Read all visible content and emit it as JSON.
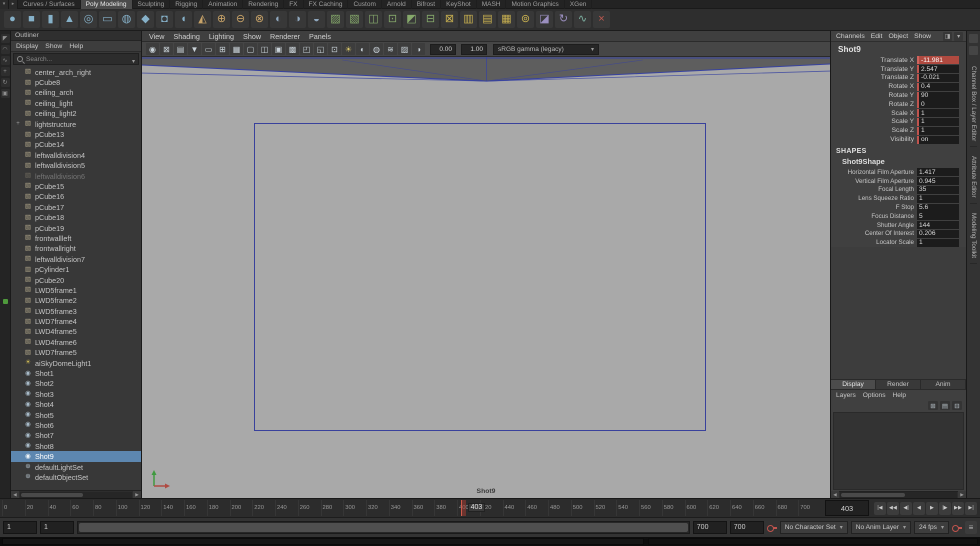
{
  "shelf": {
    "tabs": [
      {
        "label": "Curves / Surfaces"
      },
      {
        "label": "Poly Modeling",
        "cls": "active"
      },
      {
        "label": "Sculpting"
      },
      {
        "label": "Rigging"
      },
      {
        "label": "Animation"
      },
      {
        "label": "Rendering"
      },
      {
        "label": "FX"
      },
      {
        "label": "FX Caching"
      },
      {
        "label": "Custom"
      },
      {
        "label": "Arnold"
      },
      {
        "label": "Bifrost"
      },
      {
        "label": "KeyShot"
      },
      {
        "label": "MASH"
      },
      {
        "label": "Motion Graphics"
      },
      {
        "label": "XGen"
      }
    ],
    "icons": [
      {
        "name": "poly-sphere-icon",
        "glyph": "●",
        "color": "#86b1c9"
      },
      {
        "name": "poly-cube-icon",
        "glyph": "■",
        "color": "#86b1c9"
      },
      {
        "name": "poly-cylinder-icon",
        "glyph": "▮",
        "color": "#86b1c9"
      },
      {
        "name": "poly-cone-icon",
        "glyph": "▲",
        "color": "#86b1c9"
      },
      {
        "name": "poly-torus-icon",
        "glyph": "◎",
        "color": "#86b1c9"
      },
      {
        "name": "poly-plane-icon",
        "glyph": "▭",
        "color": "#86b1c9"
      },
      {
        "name": "poly-disc-icon",
        "glyph": "◍",
        "color": "#86b1c9"
      },
      {
        "name": "platonic-solid-icon",
        "glyph": "◆",
        "color": "#86b1c9"
      },
      {
        "name": "poly-pipe-icon",
        "glyph": "◘",
        "color": "#86b1c9"
      },
      {
        "name": "poly-helix-icon",
        "glyph": "◖",
        "color": "#86b1c9"
      },
      {
        "name": "sculpt-tool-icon",
        "glyph": "◭",
        "color": "#c9a469"
      },
      {
        "name": "combine-icon",
        "glyph": "⊕",
        "color": "#c9a469"
      },
      {
        "name": "separate-icon",
        "glyph": "⊖",
        "color": "#c9a469"
      },
      {
        "name": "extract-icon",
        "glyph": "⊗",
        "color": "#c9a469"
      },
      {
        "name": "boolean-union-icon",
        "glyph": "◐",
        "color": "#8fa7bd"
      },
      {
        "name": "boolean-difference-icon",
        "glyph": "◑",
        "color": "#8fa7bd"
      },
      {
        "name": "boolean-intersection-icon",
        "glyph": "◒",
        "color": "#8fa7bd"
      },
      {
        "name": "smooth-icon",
        "glyph": "▨",
        "color": "#86a96b"
      },
      {
        "name": "reduce-icon",
        "glyph": "▧",
        "color": "#86a96b"
      },
      {
        "name": "mirror-icon",
        "glyph": "◫",
        "color": "#86a96b"
      },
      {
        "name": "extrude-icon",
        "glyph": "⊡",
        "color": "#86a96b"
      },
      {
        "name": "bevel-icon",
        "glyph": "◩",
        "color": "#86a96b"
      },
      {
        "name": "bridge-icon",
        "glyph": "⊟",
        "color": "#86a96b"
      },
      {
        "name": "multi-cut-icon",
        "glyph": "⊠",
        "color": "#c8b050"
      },
      {
        "name": "insert-edge-loop-icon",
        "glyph": "▥",
        "color": "#c8b050"
      },
      {
        "name": "offset-edge-loop-icon",
        "glyph": "▤",
        "color": "#c8b050"
      },
      {
        "name": "quad-draw-icon",
        "glyph": "▦",
        "color": "#c8b050"
      },
      {
        "name": "target-weld-icon",
        "glyph": "⊚",
        "color": "#c8b050"
      },
      {
        "name": "crease-tool-icon",
        "glyph": "◪",
        "color": "#9b8fc0"
      },
      {
        "name": "spin-edge-icon",
        "glyph": "↻",
        "color": "#9b8fc0"
      },
      {
        "name": "project-curve-icon",
        "glyph": "∿",
        "color": "#7fb3a3"
      },
      {
        "name": "cut-tool-icon",
        "glyph": "×",
        "color": "#c05a50"
      }
    ]
  },
  "toolbox": {
    "tools": [
      {
        "name": "select-tool-icon",
        "glyph": "◤"
      },
      {
        "name": "lasso-tool-icon",
        "glyph": "◠"
      },
      {
        "name": "paint-select-tool-icon",
        "glyph": "∿"
      },
      {
        "name": "move-tool-icon",
        "glyph": "+"
      },
      {
        "name": "rotate-tool-icon",
        "glyph": "↻"
      },
      {
        "name": "scale-tool-icon",
        "glyph": "▣"
      }
    ]
  },
  "outliner": {
    "title": "Outliner",
    "menus": [
      "Display",
      "Show",
      "Help"
    ],
    "search_placeholder": "Search...",
    "items": [
      {
        "label": "center_arch_right",
        "glyph": "▧",
        "color": "#b3a98c",
        "exp": ""
      },
      {
        "label": "pCube8",
        "glyph": "▧",
        "color": "#b3a98c",
        "exp": ""
      },
      {
        "label": "ceiling_arch",
        "glyph": "▧",
        "color": "#b3a98c",
        "exp": ""
      },
      {
        "label": "ceiling_light",
        "glyph": "▧",
        "color": "#b3a98c",
        "exp": ""
      },
      {
        "label": "ceiling_light2",
        "glyph": "▧",
        "color": "#b3a98c",
        "exp": ""
      },
      {
        "label": "lightstructure",
        "glyph": "▧",
        "color": "#b3a98c",
        "exp": "+"
      },
      {
        "label": "pCube13",
        "glyph": "▧",
        "color": "#b3a98c",
        "exp": ""
      },
      {
        "label": "pCube14",
        "glyph": "▧",
        "color": "#b3a98c",
        "exp": ""
      },
      {
        "label": "leftwalldivision4",
        "glyph": "▧",
        "color": "#b3a98c",
        "exp": ""
      },
      {
        "label": "leftwalldivision5",
        "glyph": "▧",
        "color": "#b3a98c",
        "exp": ""
      },
      {
        "label": "leftwalldivision6",
        "glyph": "▧",
        "color": "#b3a98c",
        "exp": "",
        "cls": "dim"
      },
      {
        "label": "pCube15",
        "glyph": "▧",
        "color": "#b3a98c",
        "exp": ""
      },
      {
        "label": "pCube16",
        "glyph": "▧",
        "color": "#b3a98c",
        "exp": ""
      },
      {
        "label": "pCube17",
        "glyph": "▧",
        "color": "#b3a98c",
        "exp": ""
      },
      {
        "label": "pCube18",
        "glyph": "▧",
        "color": "#b3a98c",
        "exp": ""
      },
      {
        "label": "pCube19",
        "glyph": "▧",
        "color": "#b3a98c",
        "exp": ""
      },
      {
        "label": "frontwallleft",
        "glyph": "▧",
        "color": "#b3a98c",
        "exp": ""
      },
      {
        "label": "frontwallright",
        "glyph": "▧",
        "color": "#b3a98c",
        "exp": ""
      },
      {
        "label": "leftwalldivision7",
        "glyph": "▧",
        "color": "#b3a98c",
        "exp": ""
      },
      {
        "label": "pCylinder1",
        "glyph": "▥",
        "color": "#b3a98c",
        "exp": ""
      },
      {
        "label": "pCube20",
        "glyph": "▧",
        "color": "#b3a98c",
        "exp": ""
      },
      {
        "label": "LWD5frame1",
        "glyph": "▧",
        "color": "#b3a98c",
        "exp": ""
      },
      {
        "label": "LWD5frame2",
        "glyph": "▧",
        "color": "#b3a98c",
        "exp": ""
      },
      {
        "label": "LWD5frame3",
        "glyph": "▧",
        "color": "#b3a98c",
        "exp": ""
      },
      {
        "label": "LWD7frame4",
        "glyph": "▧",
        "color": "#b3a98c",
        "exp": ""
      },
      {
        "label": "LWD4frame5",
        "glyph": "▧",
        "color": "#b3a98c",
        "exp": ""
      },
      {
        "label": "LWD4frame6",
        "glyph": "▧",
        "color": "#b3a98c",
        "exp": ""
      },
      {
        "label": "LWD7frame5",
        "glyph": "▧",
        "color": "#b3a98c",
        "exp": ""
      },
      {
        "label": "aiSkyDomeLight1",
        "glyph": "☀",
        "color": "#d2bd55",
        "exp": ""
      },
      {
        "label": "Shot1",
        "glyph": "◉",
        "color": "#a8bac8",
        "exp": ""
      },
      {
        "label": "Shot2",
        "glyph": "◉",
        "color": "#a8bac8",
        "exp": ""
      },
      {
        "label": "Shot3",
        "glyph": "◉",
        "color": "#a8bac8",
        "exp": ""
      },
      {
        "label": "Shot4",
        "glyph": "◉",
        "color": "#a8bac8",
        "exp": ""
      },
      {
        "label": "Shot5",
        "glyph": "◉",
        "color": "#a8bac8",
        "exp": ""
      },
      {
        "label": "Shot6",
        "glyph": "◉",
        "color": "#a8bac8",
        "exp": ""
      },
      {
        "label": "Shot7",
        "glyph": "◉",
        "color": "#a8bac8",
        "exp": ""
      },
      {
        "label": "Shot8",
        "glyph": "◉",
        "color": "#a8bac8",
        "exp": ""
      },
      {
        "label": "Shot9",
        "glyph": "◉",
        "color": "#eef4f8",
        "exp": "",
        "cls": "selected"
      },
      {
        "label": "defaultLightSet",
        "glyph": "⊕",
        "color": "#a8b4bc",
        "exp": ""
      },
      {
        "label": "defaultObjectSet",
        "glyph": "⊕",
        "color": "#a8b4bc",
        "exp": ""
      }
    ]
  },
  "viewport": {
    "menus": [
      "View",
      "Shading",
      "Lighting",
      "Show",
      "Renderer",
      "Panels"
    ],
    "toolbar_icons": [
      {
        "name": "select-camera-icon",
        "glyph": "◉"
      },
      {
        "name": "lock-camera-icon",
        "glyph": "⊠"
      },
      {
        "name": "camera-attributes-icon",
        "glyph": "▤"
      },
      {
        "name": "bookmarks-icon",
        "glyph": "▼"
      },
      {
        "name": "image-plane-icon",
        "glyph": "▭"
      },
      {
        "name": "2d-pan-zoom-icon",
        "glyph": "⊞"
      },
      {
        "name": "grid-icon",
        "glyph": "▦"
      },
      {
        "name": "film-gate-icon",
        "glyph": "▢"
      },
      {
        "name": "resolution-gate-icon",
        "glyph": "◫"
      },
      {
        "name": "gate-mask-icon",
        "glyph": "▣"
      },
      {
        "name": "field-chart-icon",
        "glyph": "▩"
      },
      {
        "name": "safe-action-icon",
        "glyph": "◰"
      },
      {
        "name": "safe-title-icon",
        "glyph": "◱"
      },
      {
        "name": "frame-all-icon",
        "glyph": "⊡"
      },
      {
        "name": "lighting-icon",
        "glyph": "☀",
        "color": "#d8c66a"
      },
      {
        "name": "shadows-icon",
        "glyph": "◐"
      },
      {
        "name": "ambient-occlusion-icon",
        "glyph": "◍"
      },
      {
        "name": "motion-blur-icon",
        "glyph": "≋"
      },
      {
        "name": "multisample-icon",
        "glyph": "▨"
      },
      {
        "name": "exposure-contrast-icon",
        "glyph": "◑"
      }
    ],
    "exposure": "0.00",
    "gamma": "1.00",
    "colorspace": "sRGB gamma (legacy)",
    "camera_label": "Shot9"
  },
  "channel_box": {
    "menus": [
      "Channels",
      "Edit",
      "Object",
      "Show"
    ],
    "header_icons": [
      {
        "name": "channel-slider-mode-icon",
        "glyph": "◨"
      },
      {
        "name": "channel-speed-icon",
        "glyph": "▾"
      }
    ],
    "node_name": "Shot9",
    "transform_attrs": [
      {
        "name": "Translate X",
        "value": "-11.981",
        "cls": "sel"
      },
      {
        "name": "Translate Y",
        "value": "2.547",
        "cls": "keyed"
      },
      {
        "name": "Translate Z",
        "value": "-0.021",
        "cls": "keyed"
      },
      {
        "name": "Rotate X",
        "value": "0.4",
        "cls": "keyed"
      },
      {
        "name": "Rotate Y",
        "value": "90",
        "cls": "keyed"
      },
      {
        "name": "Rotate Z",
        "value": "0",
        "cls": "keyed"
      },
      {
        "name": "Scale X",
        "value": "1",
        "cls": "keyed"
      },
      {
        "name": "Scale Y",
        "value": "1",
        "cls": "keyed"
      },
      {
        "name": "Scale Z",
        "value": "1",
        "cls": "keyed"
      },
      {
        "name": "Visibility",
        "value": "on",
        "cls": "keyed"
      }
    ],
    "shapes_header": "SHAPES",
    "shape_node": "Shot9Shape",
    "shape_attrs": [
      {
        "name": "Horizontal Film Aperture",
        "value": "1.417"
      },
      {
        "name": "Vertical Film Aperture",
        "value": "0.945"
      },
      {
        "name": "Focal Length",
        "value": "35"
      },
      {
        "name": "Lens Squeeze Ratio",
        "value": "1"
      },
      {
        "name": "F Stop",
        "value": "5.6"
      },
      {
        "name": "Focus Distance",
        "value": "5"
      },
      {
        "name": "Shutter Angle",
        "value": "144"
      },
      {
        "name": "Center Of Interest",
        "value": "0.206"
      },
      {
        "name": "Locator Scale",
        "value": "1"
      }
    ]
  },
  "layer_editor": {
    "tabs": [
      {
        "label": "Display",
        "cls": "active"
      },
      {
        "label": "Render"
      },
      {
        "label": "Anim"
      }
    ],
    "menus": [
      "Layers",
      "Options",
      "Help"
    ],
    "buttons": [
      {
        "name": "new-empty-layer-button",
        "glyph": "⊞"
      },
      {
        "name": "new-layer-from-selected-button",
        "glyph": "▤"
      },
      {
        "name": "delete-layer-button",
        "glyph": "⊟"
      }
    ]
  },
  "side_tabs": [
    {
      "label": "Channel Box / Layer Editor"
    },
    {
      "label": "Attribute Editor"
    },
    {
      "label": "Modeling Toolkit"
    }
  ],
  "timeline": {
    "ticks": [
      0,
      20,
      40,
      60,
      80,
      100,
      120,
      140,
      160,
      180,
      200,
      220,
      240,
      260,
      280,
      300,
      320,
      340,
      360,
      380,
      400,
      420,
      440,
      460,
      480,
      500,
      520,
      540,
      560,
      580,
      600,
      620,
      640,
      660,
      680,
      700
    ],
    "current_frame": "403",
    "playback_buttons": [
      {
        "name": "go-to-start-button",
        "glyph": "|◀"
      },
      {
        "name": "step-back-key-button",
        "glyph": "◀◀"
      },
      {
        "name": "step-back-frame-button",
        "glyph": "◀|"
      },
      {
        "name": "play-backwards-button",
        "glyph": "◀"
      },
      {
        "name": "play-forward-button",
        "glyph": "▶"
      },
      {
        "name": "step-forward-frame-button",
        "glyph": "|▶"
      },
      {
        "name": "step-forward-key-button",
        "glyph": "▶▶"
      },
      {
        "name": "go-to-end-button",
        "glyph": "▶|"
      }
    ]
  },
  "range": {
    "anim_start": "1",
    "play_start": "1",
    "play_end": "700",
    "anim_end": "700"
  },
  "playback_options": {
    "character_set": "No Character Set",
    "anim_layer": "No Anim Layer",
    "fps": "24 fps"
  }
}
